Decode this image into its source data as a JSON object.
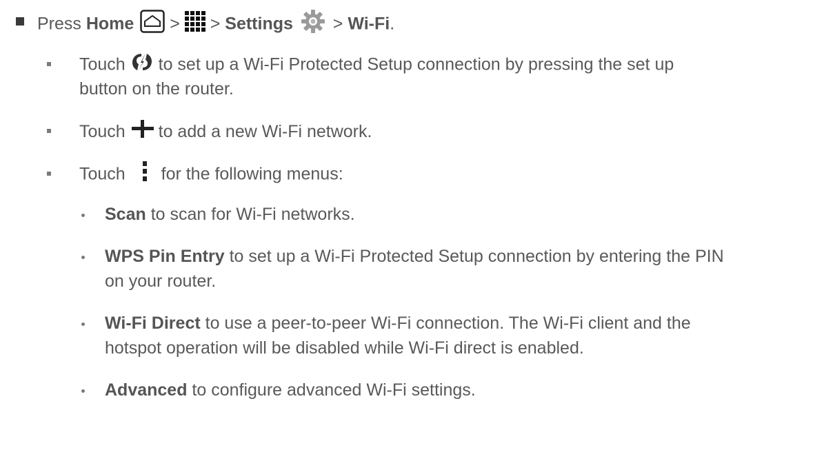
{
  "line1": {
    "press": "Press ",
    "home": "Home",
    "sep1": " > ",
    "sep2": " > ",
    "settings": "Settings",
    "sep3": " > ",
    "wifi": "Wi-Fi",
    "end": "."
  },
  "touch_wps": {
    "touch": "Touch",
    "text1": " to set up a Wi-Fi Protected Setup connection by pressing the set up",
    "text2": "button on the router."
  },
  "touch_add": {
    "touch": "Touch",
    "text": " to add a new Wi-Fi network."
  },
  "touch_menu": {
    "touch": "Touch",
    "text": " for the following menus:"
  },
  "menus": [
    {
      "bold": "Scan",
      "text": " to scan for Wi-Fi networks.",
      "text2": ""
    },
    {
      "bold": "WPS Pin Entry",
      "text": " to set up a Wi-Fi Protected Setup connection by entering the PIN",
      "text2": "on your router."
    },
    {
      "bold": "Wi-Fi Direct",
      "text": " to use a peer-to-peer Wi-Fi connection. The Wi-Fi client and the",
      "text2": "hotspot operation will be disabled while Wi-Fi direct is enabled."
    },
    {
      "bold": "Advanced",
      "text": " to configure advanced Wi-Fi settings.",
      "text2": ""
    }
  ]
}
